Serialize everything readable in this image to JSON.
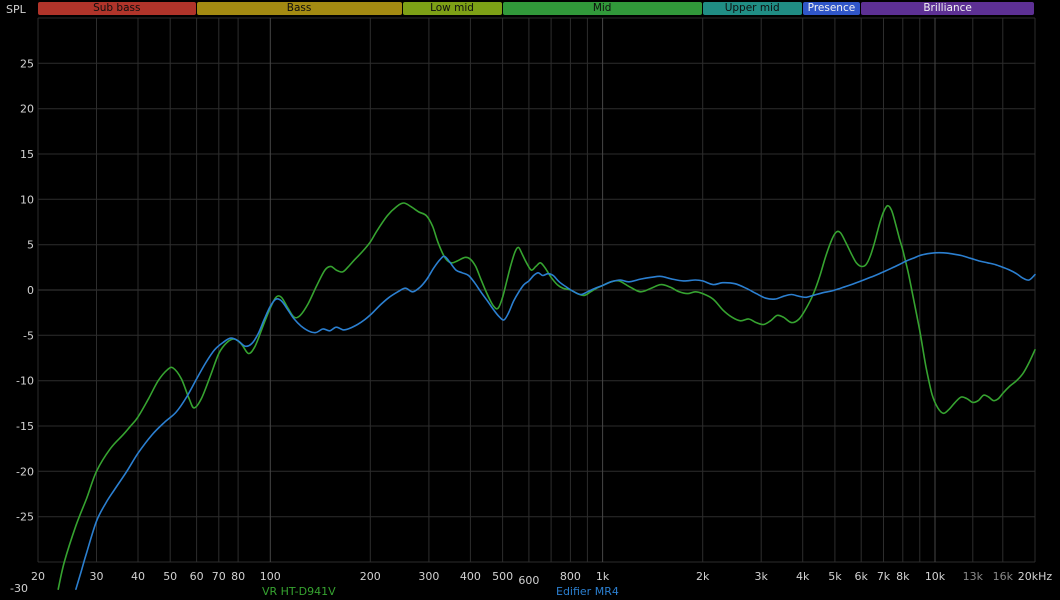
{
  "chart_data": {
    "type": "line",
    "title": "",
    "ylabel": "SPL",
    "x_scale": "log",
    "x_range": [
      20,
      20000
    ],
    "y_range": [
      -33,
      30
    ],
    "y_grid_step": 5,
    "y_ticks": [
      25,
      20,
      15,
      10,
      5,
      0,
      -5,
      -10,
      -15,
      -20,
      -25
    ],
    "y_bottom_label": "-30",
    "x_gridlines": [
      20,
      30,
      40,
      50,
      60,
      70,
      80,
      100,
      200,
      300,
      400,
      500,
      600,
      700,
      800,
      900,
      1000,
      2000,
      3000,
      4000,
      5000,
      6000,
      7000,
      8000,
      9000,
      10000,
      13000,
      16000,
      20000
    ],
    "x_ticks": [
      {
        "f": 20,
        "label": "20"
      },
      {
        "f": 30,
        "label": "30"
      },
      {
        "f": 40,
        "label": "40"
      },
      {
        "f": 50,
        "label": "50"
      },
      {
        "f": 60,
        "label": "60"
      },
      {
        "f": 70,
        "label": "70"
      },
      {
        "f": 80,
        "label": "80"
      },
      {
        "f": 100,
        "label": "100"
      },
      {
        "f": 200,
        "label": "200"
      },
      {
        "f": 300,
        "label": "300"
      },
      {
        "f": 400,
        "label": "400"
      },
      {
        "f": 500,
        "label": "500"
      },
      {
        "f": 600,
        "label": "600",
        "dy": 4
      },
      {
        "f": 800,
        "label": "800"
      },
      {
        "f": 1000,
        "label": "1k"
      },
      {
        "f": 2000,
        "label": "2k"
      },
      {
        "f": 3000,
        "label": "3k"
      },
      {
        "f": 4000,
        "label": "4k"
      },
      {
        "f": 5000,
        "label": "5k"
      },
      {
        "f": 6000,
        "label": "6k"
      },
      {
        "f": 7000,
        "label": "7k"
      },
      {
        "f": 8000,
        "label": "8k"
      },
      {
        "f": 10000,
        "label": "10k"
      },
      {
        "f": 13000,
        "label": "13k",
        "dim": true
      },
      {
        "f": 16000,
        "label": "16k",
        "dim": true
      },
      {
        "f": 20000,
        "label": "20kHz"
      }
    ],
    "colors": {
      "background": "#000000",
      "grid": "#2d2d2d",
      "grid_strong": "#464646",
      "grid_zero": "#3c3c3c",
      "tick": "#d2d2d2",
      "tick_dim": "#8a8a8a"
    },
    "bands": [
      {
        "label": "Sub bass",
        "from": 20,
        "to": 60,
        "color": "#b0342a",
        "text_color": "#0f0f0f"
      },
      {
        "label": "Bass",
        "from": 60,
        "to": 250,
        "color": "#a38a12",
        "text_color": "#0f0f0f"
      },
      {
        "label": "Low mid",
        "from": 250,
        "to": 500,
        "color": "#7da016",
        "text_color": "#0f0f0f"
      },
      {
        "label": "Mid",
        "from": 500,
        "to": 2000,
        "color": "#31983a",
        "text_color": "#0f0f0f"
      },
      {
        "label": "Upper mid",
        "from": 2000,
        "to": 4000,
        "color": "#208d84",
        "text_color": "#0f0f0f"
      },
      {
        "label": "Presence",
        "from": 4000,
        "to": 6000,
        "color": "#3056c8",
        "text_color": "#f2f2f2"
      },
      {
        "label": "Brilliance",
        "from": 6000,
        "to": 20000,
        "color": "#5d3094",
        "text_color": "#f2f2f2"
      }
    ],
    "series": [
      {
        "name": "VR HT-D941V",
        "color": "#36a330",
        "points": [
          [
            23,
            -33
          ],
          [
            24,
            -30
          ],
          [
            26,
            -26
          ],
          [
            28,
            -23
          ],
          [
            30,
            -20
          ],
          [
            33,
            -17.5
          ],
          [
            36,
            -16
          ],
          [
            38,
            -15
          ],
          [
            40,
            -14
          ],
          [
            43,
            -12
          ],
          [
            46,
            -10
          ],
          [
            49,
            -8.8
          ],
          [
            51,
            -8.6
          ],
          [
            54,
            -9.8
          ],
          [
            57,
            -12
          ],
          [
            59,
            -13
          ],
          [
            62,
            -12
          ],
          [
            66,
            -9.5
          ],
          [
            70,
            -7
          ],
          [
            74,
            -5.8
          ],
          [
            78,
            -5.4
          ],
          [
            82,
            -6
          ],
          [
            86,
            -7
          ],
          [
            90,
            -6.2
          ],
          [
            95,
            -4
          ],
          [
            100,
            -2
          ],
          [
            104,
            -0.8
          ],
          [
            108,
            -0.8
          ],
          [
            113,
            -2
          ],
          [
            118,
            -3
          ],
          [
            123,
            -2.8
          ],
          [
            130,
            -1.5
          ],
          [
            138,
            0.5
          ],
          [
            146,
            2.2
          ],
          [
            152,
            2.6
          ],
          [
            158,
            2.2
          ],
          [
            165,
            2
          ],
          [
            172,
            2.6
          ],
          [
            180,
            3.4
          ],
          [
            190,
            4.3
          ],
          [
            200,
            5.3
          ],
          [
            210,
            6.6
          ],
          [
            225,
            8.2
          ],
          [
            240,
            9.2
          ],
          [
            252,
            9.6
          ],
          [
            265,
            9.2
          ],
          [
            280,
            8.6
          ],
          [
            295,
            8.2
          ],
          [
            308,
            7
          ],
          [
            320,
            5.2
          ],
          [
            335,
            3.6
          ],
          [
            350,
            3
          ],
          [
            365,
            3.2
          ],
          [
            385,
            3.6
          ],
          [
            400,
            3.4
          ],
          [
            415,
            2.6
          ],
          [
            430,
            1.2
          ],
          [
            450,
            -0.5
          ],
          [
            470,
            -1.8
          ],
          [
            485,
            -2
          ],
          [
            500,
            -0.8
          ],
          [
            515,
            1
          ],
          [
            530,
            2.8
          ],
          [
            545,
            4.2
          ],
          [
            558,
            4.7
          ],
          [
            572,
            4
          ],
          [
            590,
            3
          ],
          [
            610,
            2.2
          ],
          [
            630,
            2.6
          ],
          [
            650,
            3
          ],
          [
            672,
            2.4
          ],
          [
            700,
            1.4
          ],
          [
            730,
            0.6
          ],
          [
            760,
            0.2
          ],
          [
            800,
            0
          ],
          [
            840,
            -0.4
          ],
          [
            880,
            -0.6
          ],
          [
            920,
            -0.2
          ],
          [
            960,
            0.2
          ],
          [
            1000,
            0.5
          ],
          [
            1060,
            0.9
          ],
          [
            1120,
            1
          ],
          [
            1200,
            0.4
          ],
          [
            1300,
            -0.2
          ],
          [
            1400,
            0.2
          ],
          [
            1500,
            0.6
          ],
          [
            1600,
            0.3
          ],
          [
            1700,
            -0.2
          ],
          [
            1800,
            -0.4
          ],
          [
            1900,
            -0.2
          ],
          [
            2000,
            -0.4
          ],
          [
            2150,
            -1
          ],
          [
            2300,
            -2.2
          ],
          [
            2450,
            -3
          ],
          [
            2600,
            -3.4
          ],
          [
            2750,
            -3.2
          ],
          [
            2900,
            -3.6
          ],
          [
            3050,
            -3.8
          ],
          [
            3200,
            -3.4
          ],
          [
            3350,
            -2.8
          ],
          [
            3500,
            -3
          ],
          [
            3700,
            -3.6
          ],
          [
            3900,
            -3.2
          ],
          [
            4100,
            -2
          ],
          [
            4300,
            -0.5
          ],
          [
            4500,
            1.5
          ],
          [
            4700,
            3.8
          ],
          [
            4900,
            5.6
          ],
          [
            5050,
            6.4
          ],
          [
            5200,
            6.3
          ],
          [
            5400,
            5.2
          ],
          [
            5600,
            4
          ],
          [
            5800,
            3
          ],
          [
            6000,
            2.6
          ],
          [
            6200,
            2.8
          ],
          [
            6400,
            3.8
          ],
          [
            6600,
            5.4
          ],
          [
            6800,
            7.2
          ],
          [
            7000,
            8.6
          ],
          [
            7200,
            9.3
          ],
          [
            7400,
            8.8
          ],
          [
            7600,
            7.4
          ],
          [
            7800,
            5.8
          ],
          [
            8000,
            4.4
          ],
          [
            8300,
            2
          ],
          [
            8600,
            -0.8
          ],
          [
            9000,
            -4.5
          ],
          [
            9400,
            -8.5
          ],
          [
            9800,
            -11.5
          ],
          [
            10200,
            -13
          ],
          [
            10600,
            -13.6
          ],
          [
            11000,
            -13.2
          ],
          [
            11500,
            -12.4
          ],
          [
            12000,
            -11.8
          ],
          [
            12500,
            -12
          ],
          [
            13000,
            -12.4
          ],
          [
            13500,
            -12.2
          ],
          [
            14000,
            -11.6
          ],
          [
            14500,
            -11.8
          ],
          [
            15000,
            -12.2
          ],
          [
            15500,
            -12
          ],
          [
            16000,
            -11.4
          ],
          [
            16800,
            -10.6
          ],
          [
            17600,
            -10
          ],
          [
            18400,
            -9.2
          ],
          [
            19200,
            -8
          ],
          [
            20000,
            -6.6
          ]
        ]
      },
      {
        "name": "Edifier MR4",
        "color": "#2b7fd0",
        "points": [
          [
            26,
            -33
          ],
          [
            27,
            -31
          ],
          [
            28,
            -29
          ],
          [
            30,
            -25.5
          ],
          [
            32,
            -23.5
          ],
          [
            34,
            -22
          ],
          [
            37,
            -20
          ],
          [
            40,
            -18
          ],
          [
            44,
            -16
          ],
          [
            48,
            -14.6
          ],
          [
            52,
            -13.5
          ],
          [
            56,
            -11.8
          ],
          [
            60,
            -9.8
          ],
          [
            64,
            -8
          ],
          [
            68,
            -6.6
          ],
          [
            72,
            -5.8
          ],
          [
            76,
            -5.3
          ],
          [
            80,
            -5.6
          ],
          [
            84,
            -6.2
          ],
          [
            88,
            -5.9
          ],
          [
            92,
            -4.8
          ],
          [
            96,
            -3.2
          ],
          [
            100,
            -1.8
          ],
          [
            104,
            -1
          ],
          [
            108,
            -1.2
          ],
          [
            113,
            -2.2
          ],
          [
            118,
            -3.2
          ],
          [
            124,
            -4
          ],
          [
            130,
            -4.5
          ],
          [
            137,
            -4.7
          ],
          [
            144,
            -4.3
          ],
          [
            151,
            -4.5
          ],
          [
            158,
            -4.1
          ],
          [
            166,
            -4.4
          ],
          [
            174,
            -4.2
          ],
          [
            183,
            -3.8
          ],
          [
            192,
            -3.3
          ],
          [
            202,
            -2.6
          ],
          [
            215,
            -1.6
          ],
          [
            228,
            -0.8
          ],
          [
            242,
            -0.2
          ],
          [
            255,
            0.2
          ],
          [
            268,
            -0.2
          ],
          [
            282,
            0.3
          ],
          [
            296,
            1.2
          ],
          [
            310,
            2.4
          ],
          [
            325,
            3.4
          ],
          [
            335,
            3.7
          ],
          [
            348,
            3
          ],
          [
            362,
            2.2
          ],
          [
            378,
            1.9
          ],
          [
            395,
            1.6
          ],
          [
            412,
            0.8
          ],
          [
            430,
            -0.2
          ],
          [
            450,
            -1.2
          ],
          [
            470,
            -2.2
          ],
          [
            490,
            -3
          ],
          [
            505,
            -3.3
          ],
          [
            520,
            -2.6
          ],
          [
            540,
            -1.2
          ],
          [
            560,
            -0.2
          ],
          [
            580,
            0.6
          ],
          [
            600,
            1
          ],
          [
            620,
            1.6
          ],
          [
            640,
            1.9
          ],
          [
            660,
            1.6
          ],
          [
            685,
            1.8
          ],
          [
            710,
            1.6
          ],
          [
            740,
            0.9
          ],
          [
            780,
            0.3
          ],
          [
            820,
            -0.2
          ],
          [
            860,
            -0.5
          ],
          [
            900,
            -0.2
          ],
          [
            950,
            0.2
          ],
          [
            1000,
            0.5
          ],
          [
            1060,
            0.9
          ],
          [
            1130,
            1.1
          ],
          [
            1200,
            0.9
          ],
          [
            1300,
            1.2
          ],
          [
            1400,
            1.4
          ],
          [
            1500,
            1.5
          ],
          [
            1620,
            1.2
          ],
          [
            1750,
            1
          ],
          [
            1900,
            1.1
          ],
          [
            2000,
            1
          ],
          [
            2150,
            0.6
          ],
          [
            2300,
            0.8
          ],
          [
            2500,
            0.7
          ],
          [
            2700,
            0.2
          ],
          [
            2900,
            -0.4
          ],
          [
            3100,
            -0.9
          ],
          [
            3300,
            -1
          ],
          [
            3500,
            -0.7
          ],
          [
            3700,
            -0.5
          ],
          [
            3900,
            -0.7
          ],
          [
            4100,
            -0.8
          ],
          [
            4300,
            -0.6
          ],
          [
            4600,
            -0.3
          ],
          [
            4900,
            -0.1
          ],
          [
            5200,
            0.2
          ],
          [
            5500,
            0.5
          ],
          [
            5800,
            0.8
          ],
          [
            6100,
            1.1
          ],
          [
            6400,
            1.4
          ],
          [
            6700,
            1.7
          ],
          [
            7000,
            2
          ],
          [
            7400,
            2.4
          ],
          [
            7800,
            2.8
          ],
          [
            8200,
            3.2
          ],
          [
            8600,
            3.5
          ],
          [
            9000,
            3.8
          ],
          [
            9500,
            4
          ],
          [
            10000,
            4.1
          ],
          [
            10600,
            4.1
          ],
          [
            11200,
            4
          ],
          [
            12000,
            3.8
          ],
          [
            12800,
            3.5
          ],
          [
            13600,
            3.2
          ],
          [
            14400,
            3
          ],
          [
            15200,
            2.8
          ],
          [
            16000,
            2.5
          ],
          [
            16800,
            2.2
          ],
          [
            17600,
            1.8
          ],
          [
            18400,
            1.3
          ],
          [
            19200,
            1.1
          ],
          [
            20000,
            1.7
          ]
        ]
      }
    ]
  }
}
